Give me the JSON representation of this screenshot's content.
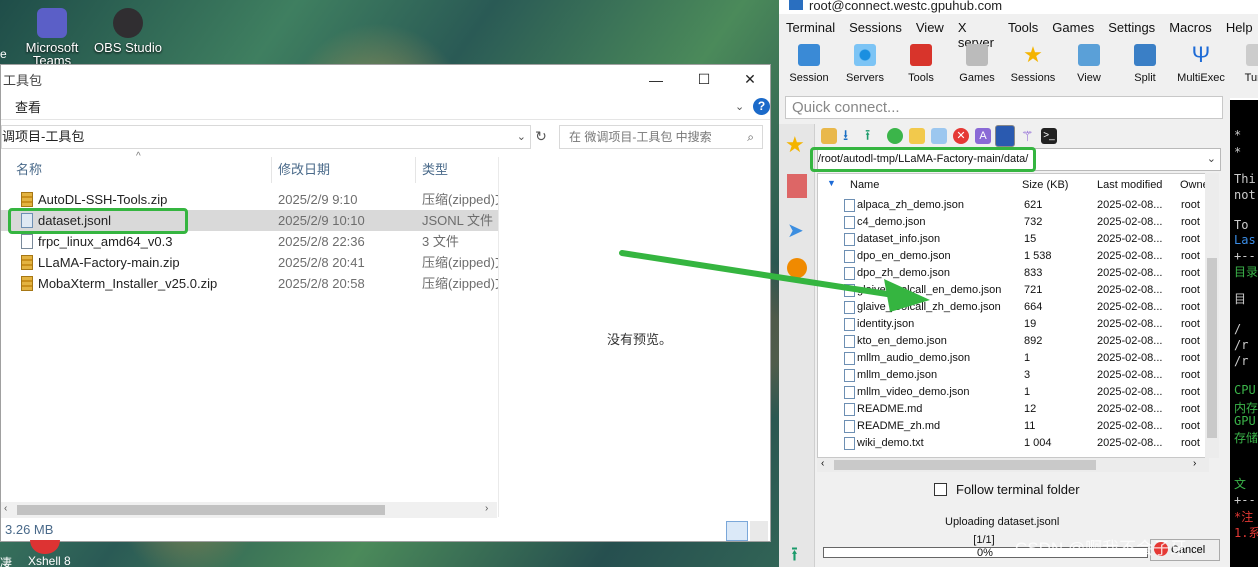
{
  "desktop": {
    "icons": [
      {
        "label": "Microsoft",
        "label2": "Teams"
      },
      {
        "label": "OBS Studio"
      }
    ],
    "left_fragment": "e",
    "taskbar_left": "Xshell 8",
    "taskbar_left_prefix": "凄"
  },
  "explorer": {
    "title": "工具包",
    "window_buttons": {
      "minimize": "—",
      "maximize": "☐",
      "close": "✕"
    },
    "ribbon_tab": "查看",
    "address": "调项目-工具包",
    "search_placeholder": "在 微调项目-工具包 中搜索",
    "columns": {
      "name": "名称",
      "date": "修改日期",
      "type": "类型"
    },
    "files": [
      {
        "name": "AutoDL-SSH-Tools.zip",
        "date": "2025/2/9 9:10",
        "type": "压缩(zipped)文"
      },
      {
        "name": "dataset.jsonl",
        "date": "2025/2/9 10:10",
        "type": "JSONL 文件"
      },
      {
        "name": "frpc_linux_amd64_v0.3",
        "date": "2025/2/8 22:36",
        "type": "3 文件"
      },
      {
        "name": "LLaMA-Factory-main.zip",
        "date": "2025/2/8 20:41",
        "type": "压缩(zipped)文"
      },
      {
        "name": "MobaXterm_Installer_v25.0.zip",
        "date": "2025/2/8 20:58",
        "type": "压缩(zipped)文"
      }
    ],
    "preview_text": "没有预览。",
    "status": "3.26 MB"
  },
  "moba": {
    "title": "root@connect.westc.gpuhub.com",
    "menu": [
      "Terminal",
      "Sessions",
      "View",
      "X server",
      "Tools",
      "Games",
      "Settings",
      "Macros",
      "Help"
    ],
    "toolbar": [
      "Session",
      "Servers",
      "Tools",
      "Games",
      "Sessions",
      "View",
      "Split",
      "MultiExec",
      "Tunn"
    ],
    "quick_connect": "Quick connect...",
    "path": "/root/autodl-tmp/LLaMA-Factory-main/data/",
    "columns": {
      "name": "Name",
      "size": "Size (KB)",
      "modified": "Last modified",
      "owner": "Owne"
    },
    "files": [
      {
        "name": "alpaca_zh_demo.json",
        "size": "621",
        "modified": "2025-02-08...",
        "owner": "root"
      },
      {
        "name": "c4_demo.json",
        "size": "732",
        "modified": "2025-02-08...",
        "owner": "root"
      },
      {
        "name": "dataset_info.json",
        "size": "15",
        "modified": "2025-02-08...",
        "owner": "root"
      },
      {
        "name": "dpo_en_demo.json",
        "size": "1 538",
        "modified": "2025-02-08...",
        "owner": "root"
      },
      {
        "name": "dpo_zh_demo.json",
        "size": "833",
        "modified": "2025-02-08...",
        "owner": "root"
      },
      {
        "name": "glaive_toolcall_en_demo.json",
        "size": "721",
        "modified": "2025-02-08...",
        "owner": "root"
      },
      {
        "name": "glaive_toolcall_zh_demo.json",
        "size": "664",
        "modified": "2025-02-08...",
        "owner": "root"
      },
      {
        "name": "identity.json",
        "size": "19",
        "modified": "2025-02-08...",
        "owner": "root"
      },
      {
        "name": "kto_en_demo.json",
        "size": "892",
        "modified": "2025-02-08...",
        "owner": "root"
      },
      {
        "name": "mllm_audio_demo.json",
        "size": "1",
        "modified": "2025-02-08...",
        "owner": "root"
      },
      {
        "name": "mllm_demo.json",
        "size": "3",
        "modified": "2025-02-08...",
        "owner": "root"
      },
      {
        "name": "mllm_video_demo.json",
        "size": "1",
        "modified": "2025-02-08...",
        "owner": "root"
      },
      {
        "name": "README.md",
        "size": "12",
        "modified": "2025-02-08...",
        "owner": "root"
      },
      {
        "name": "README_zh.md",
        "size": "11",
        "modified": "2025-02-08...",
        "owner": "root"
      },
      {
        "name": "wiki_demo.txt",
        "size": "1 004",
        "modified": "2025-02-08...",
        "owner": "root"
      }
    ],
    "follow_label": "Follow terminal folder",
    "uploading": "Uploading dataset.jsonl",
    "progress_count": "[1/1]",
    "progress_percent": "0%",
    "progress_value": 0,
    "cancel": "Cancel",
    "terminal_lines": [
      "*",
      "*",
      "Thi",
      "not",
      "To",
      "Las",
      "+--",
      "目录",
      "目",
      "/",
      "/r",
      "/r",
      "CPU",
      "内存",
      "GPU",
      "存储",
      "  ",
      "  ",
      "文",
      "+--",
      "*注",
      "1.系"
    ]
  },
  "watermark": "CSDN @啊我不会子牙",
  "colors": {
    "highlight": "#35b540",
    "selection": "#cce8ff"
  }
}
